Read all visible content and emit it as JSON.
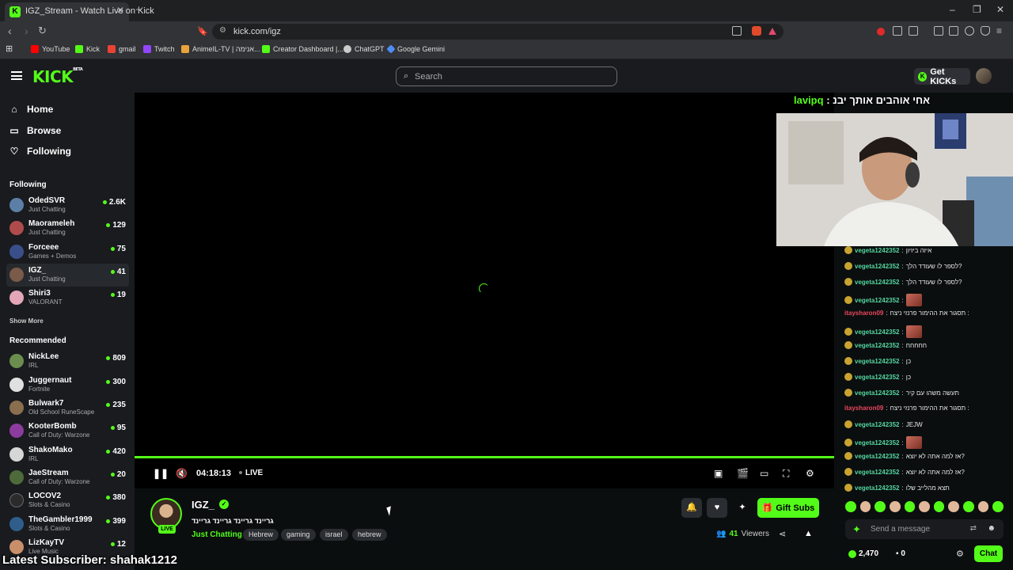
{
  "browser": {
    "tab_title": "IGZ_Stream - Watch Live on Kick",
    "url": "kick.com/igz",
    "bookmarks": [
      {
        "label": "YouTube",
        "color": "#ff0000"
      },
      {
        "label": "Kick",
        "color": "#53fc18"
      },
      {
        "label": "gmail",
        "color": "#ea4335"
      },
      {
        "label": "Twitch",
        "color": "#9146ff"
      },
      {
        "label": "AnimeIL-TV | אנימה...",
        "color": "#e8a33c"
      },
      {
        "label": "Creator Dashboard |...",
        "color": "#53fc18"
      },
      {
        "label": "ChatGPT",
        "color": "#cccccc"
      },
      {
        "label": "Google Gemini",
        "color": "#4e8cf5"
      }
    ]
  },
  "header": {
    "logo": "KICK",
    "logo_beta": "BETA",
    "search_placeholder": "Search",
    "get_kicks": "Get KICKs"
  },
  "sidebar": {
    "nav": [
      {
        "label": "Home",
        "icon": "home-icon"
      },
      {
        "label": "Browse",
        "icon": "browse-icon"
      },
      {
        "label": "Following",
        "icon": "heart-icon"
      }
    ],
    "following_title": "Following",
    "following": [
      {
        "name": "OdedSVR",
        "category": "Just Chatting",
        "viewers": "2.6K",
        "color": "#5c7fa8"
      },
      {
        "name": "Maorameleh",
        "category": "Just Chatting",
        "viewers": "129",
        "color": "#b04b4b"
      },
      {
        "name": "Forceee",
        "category": "Games + Demos",
        "viewers": "75",
        "color": "#3a4f8a"
      },
      {
        "name": "IGZ_",
        "category": "Just Chatting",
        "viewers": "41",
        "color": "#7a5a48"
      },
      {
        "name": "Shiri3",
        "category": "VALORANT",
        "viewers": "19",
        "color": "#e3a6b8"
      }
    ],
    "show_more": "Show More",
    "recommended_title": "Recommended",
    "recommended": [
      {
        "name": "NickLee",
        "category": "IRL",
        "viewers": "809",
        "color": "#6b8e4e"
      },
      {
        "name": "Juggernaut",
        "category": "Fortnite",
        "viewers": "300",
        "color": "#e0e0e0"
      },
      {
        "name": "Bulwark7",
        "category": "Old School RuneScape",
        "viewers": "235",
        "color": "#8a6f4e"
      },
      {
        "name": "KooterBomb",
        "category": "Call of Duty: Warzone",
        "viewers": "95",
        "color": "#8c3c9e"
      },
      {
        "name": "ShakoMako",
        "category": "IRL",
        "viewers": "420",
        "color": "#d6d6d6"
      },
      {
        "name": "JaeStream",
        "category": "Call of Duty: Warzone",
        "viewers": "20",
        "color": "#4d6b3a"
      },
      {
        "name": "LOCOV2",
        "category": "Slots & Casino",
        "viewers": "380",
        "color": "#2b2b2b"
      },
      {
        "name": "TheGambler1999",
        "category": "Slots & Casino",
        "viewers": "399",
        "color": "#2f5e8a"
      },
      {
        "name": "LizKayTV",
        "category": "Live Music",
        "viewers": "12",
        "color": "#c98f6a"
      }
    ]
  },
  "player": {
    "time": "04:18:13",
    "live_label": "LIVE",
    "overlay_message_user": "lavipq",
    "overlay_message_text": " : אחי אוהבים אותך יבנ"
  },
  "stream": {
    "name": "IGZ_",
    "live_badge": "LIVE",
    "title": "גריינד גריינד גריינד גריינד",
    "category": "Just Chatting",
    "tags": [
      "Hebrew",
      "gaming",
      "israel",
      "hebrew"
    ],
    "gift_subs": "Gift Subs",
    "viewers": "41",
    "viewers_label": "Viewers"
  },
  "chat": {
    "messages": [
      {
        "user": "vegeta1242352",
        "text": "איזה ביזיון",
        "red": false,
        "emote": false
      },
      {
        "user": "vegeta1242352",
        "text": "לספר לו שעודד הלך?",
        "red": false,
        "emote": false
      },
      {
        "user": "vegeta1242352",
        "text": "לספר לו שעודד הלך?",
        "red": false,
        "emote": false
      },
      {
        "user": "vegeta1242352",
        "text": "",
        "red": false,
        "emote": true
      },
      {
        "user": "itaysharon09",
        "text": "תסגור את ההימור פרנזי ניצח :",
        "red": true,
        "emote": false
      },
      {
        "user": "vegeta1242352",
        "text": "",
        "red": false,
        "emote": true
      },
      {
        "user": "vegeta1242352",
        "text": "חחחחח",
        "red": false,
        "emote": false
      },
      {
        "user": "vegeta1242352",
        "text": "כן",
        "red": false,
        "emote": false
      },
      {
        "user": "vegeta1242352",
        "text": "כן",
        "red": false,
        "emote": false
      },
      {
        "user": "vegeta1242352",
        "text": "תעשה משהו עם קיר",
        "red": false,
        "emote": false
      },
      {
        "user": "itaysharon09",
        "text": "תסגור את ההימור פרנזי ניצח :",
        "red": true,
        "emote": false
      },
      {
        "user": "vegeta1242352",
        "text": "JEJW",
        "red": false,
        "emote": false
      },
      {
        "user": "vegeta1242352",
        "text": "",
        "red": false,
        "emote": true
      },
      {
        "user": "vegeta1242352",
        "text": "אז למה אתה לא יוצא?",
        "red": false,
        "emote": false
      },
      {
        "user": "vegeta1242352",
        "text": "אז למה אתה לא יוצא?",
        "red": false,
        "emote": false
      },
      {
        "user": "vegeta1242352",
        "text": "תצא מהלייב שלו",
        "red": false,
        "emote": false
      }
    ],
    "input_placeholder": "Send a message",
    "kicks_count": "2,470",
    "points_count": "0",
    "chat_button": "Chat"
  },
  "overlay": {
    "latest_subscriber": "Latest Subscriber: shahak1212"
  }
}
